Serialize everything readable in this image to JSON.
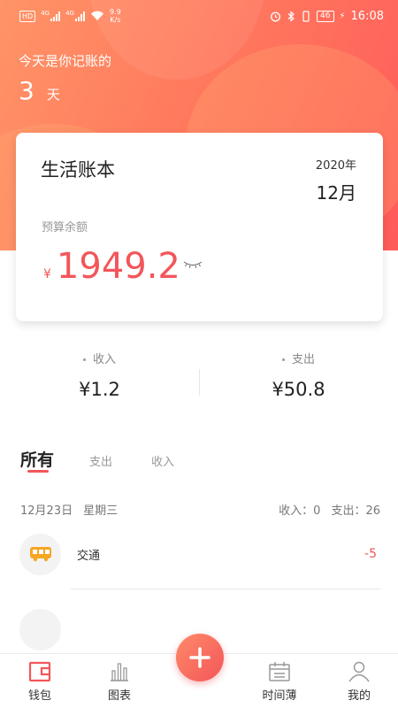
{
  "status_bar": {
    "hd_badge": "HD",
    "network1": "4G",
    "network2": "4G",
    "speed_value": "9.9",
    "speed_unit": "K/s",
    "battery": "46",
    "time": "16:08"
  },
  "header": {
    "days_label": "今天是你记账的",
    "days_count": "3",
    "days_unit": "天"
  },
  "book_card": {
    "title": "生活账本",
    "year": "2020年",
    "month": "12月",
    "budget_label": "预算余额",
    "currency": "¥",
    "budget_value": "1949.2"
  },
  "stats": {
    "income_label": "收入",
    "income_value": "¥1.2",
    "expense_label": "支出",
    "expense_value": "¥50.8"
  },
  "filter_tabs": [
    {
      "label": "所有",
      "active": true
    },
    {
      "label": "支出",
      "active": false
    },
    {
      "label": "收入",
      "active": false
    }
  ],
  "day_group": {
    "date": "12月23日",
    "weekday": "星期三",
    "income_summary": "收入：0",
    "expense_summary": "支出：26"
  },
  "entries": [
    {
      "icon": "bus-icon",
      "name": "交通",
      "amount": "-5"
    }
  ],
  "bottom_nav": [
    {
      "label": "钱包",
      "icon": "wallet-icon",
      "active": true
    },
    {
      "label": "图表",
      "icon": "chart-icon",
      "active": false
    },
    {
      "label": "时间薄",
      "icon": "calendar-icon",
      "active": false
    },
    {
      "label": "我的",
      "icon": "person-icon",
      "active": false
    }
  ],
  "colors": {
    "accent": "#f2565a",
    "hero_start": "#ff9466",
    "hero_end": "#ff5a5a",
    "bus_icon": "#f5a623"
  }
}
